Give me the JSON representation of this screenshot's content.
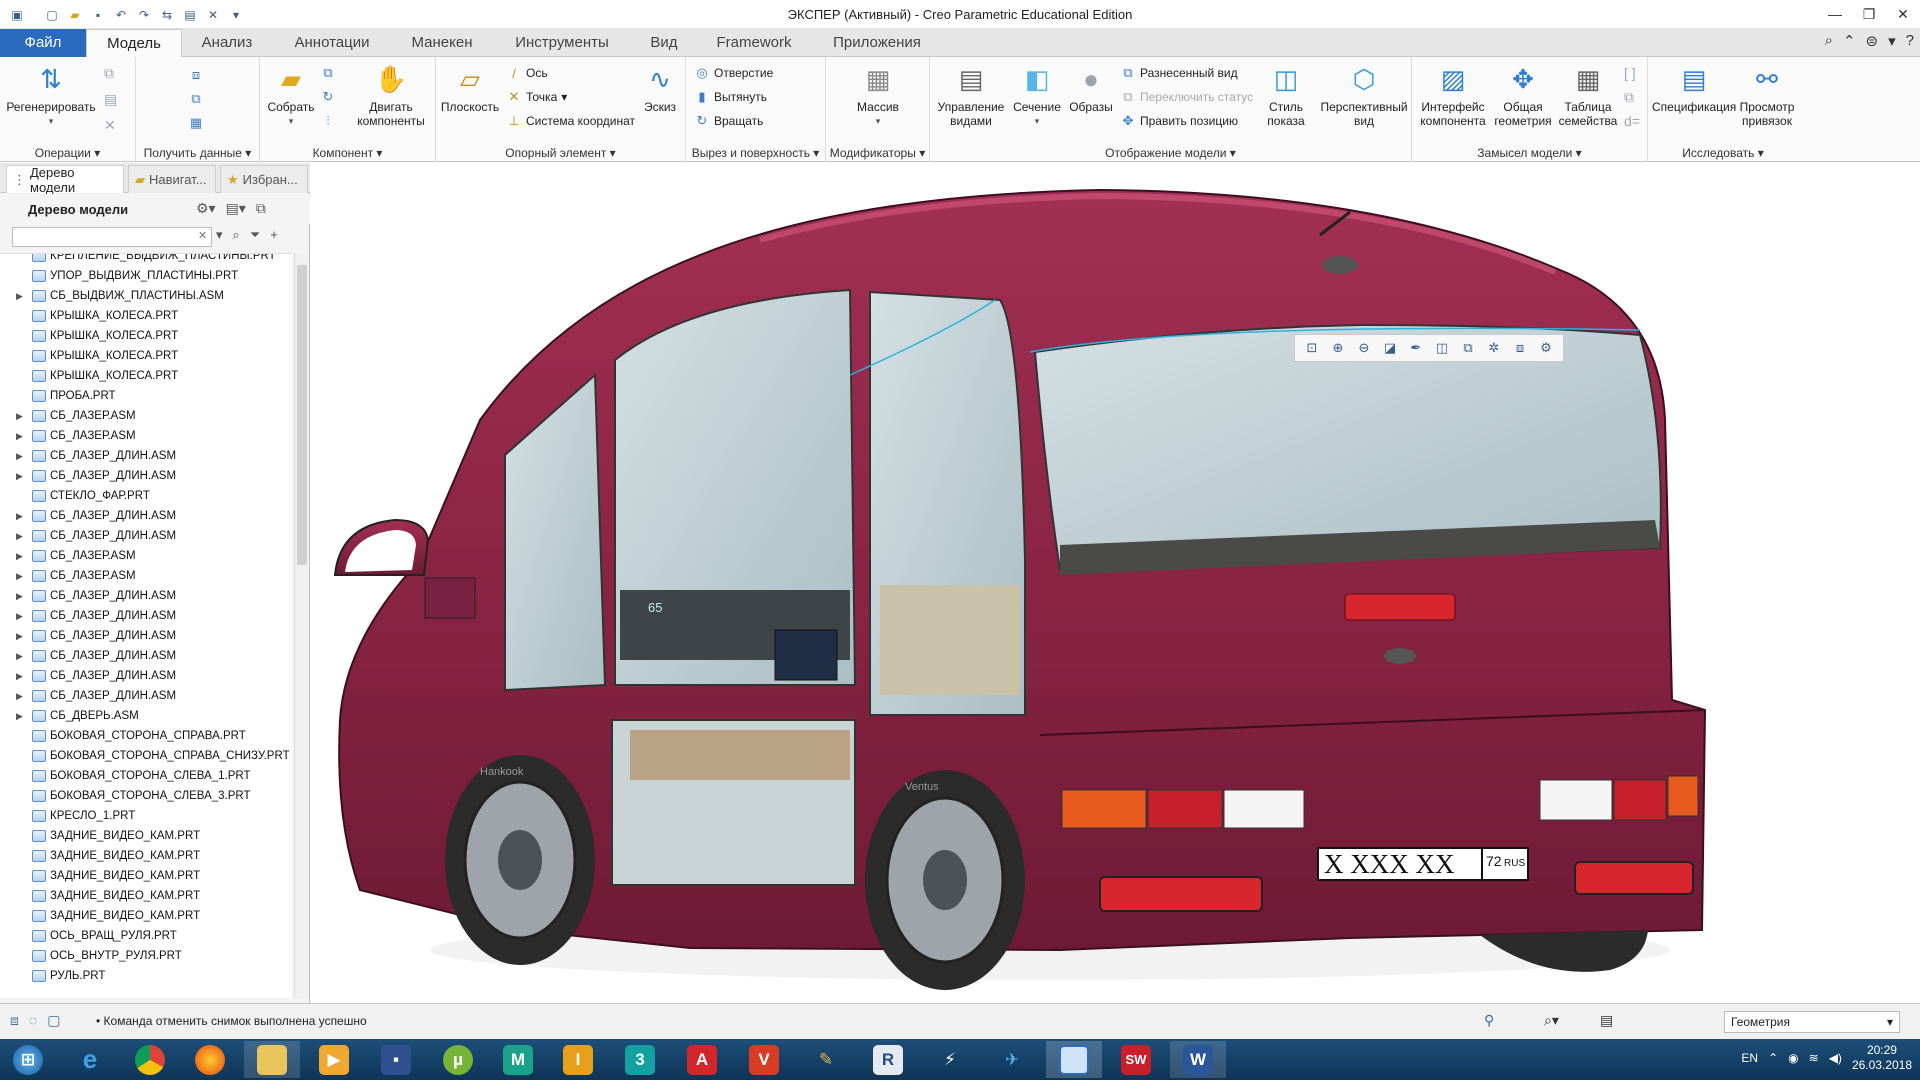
{
  "window": {
    "title": "ЭКСПЕР (Активный) - Creo Parametric Educational Edition"
  },
  "tabs": [
    {
      "label": "Файл"
    },
    {
      "label": "Модель"
    },
    {
      "label": "Анализ"
    },
    {
      "label": "Аннотации"
    },
    {
      "label": "Манекен"
    },
    {
      "label": "Инструменты"
    },
    {
      "label": "Вид"
    },
    {
      "label": "Framework"
    },
    {
      "label": "Приложения"
    }
  ],
  "ribbon": {
    "operations": {
      "label": "Операции",
      "regenerate": "Регенерировать"
    },
    "get_data": {
      "label": "Получить данные"
    },
    "component": {
      "label": "Компонент",
      "assemble": "Собрать",
      "move_components": "Двигать компоненты"
    },
    "datum": {
      "label": "Опорный элемент",
      "plane": "Плоскость",
      "axis": "Ось",
      "point": "Точка",
      "csys": "Система координат",
      "sketch": "Эскиз"
    },
    "cut_surface": {
      "label": "Вырез и поверхность",
      "hole": "Отверстие",
      "extrude": "Вытянуть",
      "revolve": "Вращать"
    },
    "modifiers": {
      "label": "Модификаторы",
      "pattern": "Массив"
    },
    "model_display": {
      "label": "Отображение модели",
      "manage_views": "Управление видами",
      "section": "Сечение",
      "appearances": "Образы",
      "exploded_view": "Разнесенный вид",
      "toggle_status": "Переключить статус",
      "edit_position": "Править позицию",
      "display_style": "Стиль показа",
      "perspective_view": "Перспективный вид"
    },
    "design_intent": {
      "label": "Замысел модели",
      "component_interface": "Интерфейс компонента",
      "publish_geometry": "Общая геометрия",
      "family_table": "Таблица семейства"
    },
    "investigate": {
      "label": "Исследовать",
      "bom": "Спецификация",
      "reference_viewer": "Просмотр привязок"
    }
  },
  "panel": {
    "tabs": [
      {
        "label": "Дерево модели"
      },
      {
        "label": "Навигат..."
      },
      {
        "label": "Избран..."
      }
    ],
    "tree_title": "Дерево модели",
    "search_value": ""
  },
  "tree": [
    {
      "label": "КРЕПЛЕНИЕ_ВЫДВИЖ_ПЛАСТИНЫ.PRT",
      "expandable": false
    },
    {
      "label": "УПОР_ВЫДВИЖ_ПЛАСТИНЫ.PRT",
      "expandable": false
    },
    {
      "label": "СБ_ВЫДВИЖ_ПЛАСТИНЫ.ASM",
      "expandable": true
    },
    {
      "label": "КРЫШКА_КОЛЕСА.PRT",
      "expandable": false
    },
    {
      "label": "КРЫШКА_КОЛЕСА.PRT",
      "expandable": false
    },
    {
      "label": "КРЫШКА_КОЛЕСА.PRT",
      "expandable": false
    },
    {
      "label": "КРЫШКА_КОЛЕСА.PRT",
      "expandable": false
    },
    {
      "label": "ПРОБА.PRT",
      "expandable": false
    },
    {
      "label": "СБ_ЛАЗЕР.ASM",
      "expandable": true
    },
    {
      "label": "СБ_ЛАЗЕР.ASM",
      "expandable": true
    },
    {
      "label": "СБ_ЛАЗЕР_ДЛИН.ASM",
      "expandable": true
    },
    {
      "label": "СБ_ЛАЗЕР_ДЛИН.ASM",
      "expandable": true
    },
    {
      "label": "СТЕКЛО_ФАР.PRT",
      "expandable": false
    },
    {
      "label": "СБ_ЛАЗЕР_ДЛИН.ASM",
      "expandable": true
    },
    {
      "label": "СБ_ЛАЗЕР_ДЛИН.ASM",
      "expandable": true
    },
    {
      "label": "СБ_ЛАЗЕР.ASM",
      "expandable": true
    },
    {
      "label": "СБ_ЛАЗЕР.ASM",
      "expandable": true
    },
    {
      "label": "СБ_ЛАЗЕР_ДЛИН.ASM",
      "expandable": true
    },
    {
      "label": "СБ_ЛАЗЕР_ДЛИН.ASM",
      "expandable": true
    },
    {
      "label": "СБ_ЛАЗЕР_ДЛИН.ASM",
      "expandable": true
    },
    {
      "label": "СБ_ЛАЗЕР_ДЛИН.ASM",
      "expandable": true
    },
    {
      "label": "СБ_ЛАЗЕР_ДЛИН.ASM",
      "expandable": true
    },
    {
      "label": "СБ_ЛАЗЕР_ДЛИН.ASM",
      "expandable": true
    },
    {
      "label": "СБ_ДВЕРЬ.ASM",
      "expandable": true
    },
    {
      "label": "БОКОВАЯ_СТОРОНА_СПРАВА.PRT",
      "expandable": false
    },
    {
      "label": "БОКОВАЯ_СТОРОНА_СПРАВА_СНИЗУ.PRT",
      "expandable": false
    },
    {
      "label": "БОКОВАЯ_СТОРОНА_СЛЕВА_1.PRT",
      "expandable": false
    },
    {
      "label": "БОКОВАЯ_СТОРОНА_СЛЕВА_3.PRT",
      "expandable": false
    },
    {
      "label": "КРЕСЛО_1.PRT",
      "expandable": false
    },
    {
      "label": "ЗАДНИЕ_ВИДЕО_КАМ.PRT",
      "expandable": false
    },
    {
      "label": "ЗАДНИЕ_ВИДЕО_КАМ.PRT",
      "expandable": false
    },
    {
      "label": "ЗАДНИЕ_ВИДЕО_КАМ.PRT",
      "expandable": false
    },
    {
      "label": "ЗАДНИЕ_ВИДЕО_КАМ.PRT",
      "expandable": false
    },
    {
      "label": "ЗАДНИЕ_ВИДЕО_КАМ.PRT",
      "expandable": false
    },
    {
      "label": "ОСЬ_ВРАЩ_РУЛЯ.PRT",
      "expandable": false
    },
    {
      "label": "ОСЬ_ВНУТР_РУЛЯ.PRT",
      "expandable": false
    },
    {
      "label": "РУЛЬ.PRT",
      "expandable": false
    }
  ],
  "viewport": {
    "plate_number": "X XXX XX",
    "plate_region": "72",
    "plate_country": "RUS",
    "dashboard_speed": "65",
    "tire_text": "Hankook",
    "tire_text_2": "Ventus"
  },
  "status": {
    "message": "Команда отменить снимок выполнена успешно",
    "filter_value": "Геометрия"
  },
  "taskbar": {
    "lang": "EN",
    "time": "20:29",
    "date": "26.03.2018"
  },
  "colors": {
    "body": "#8c2546",
    "file_tab": "#2b6bbd",
    "taskbar": "#173f63"
  }
}
